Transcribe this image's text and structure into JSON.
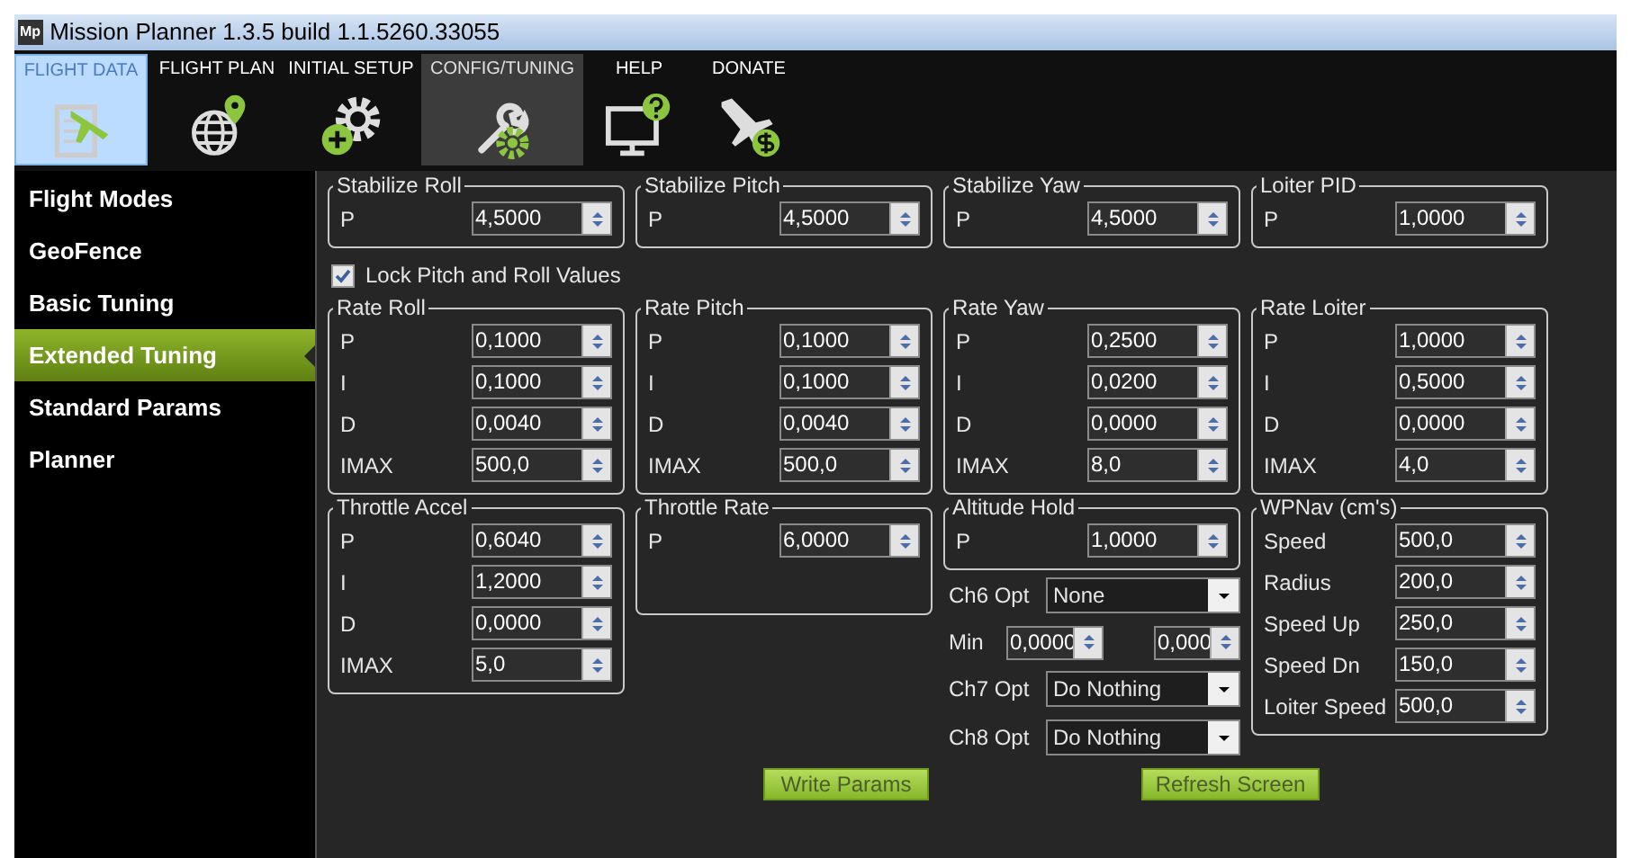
{
  "window": {
    "logo": "Mp",
    "title": "Mission Planner 1.3.5 build 1.1.5260.33055"
  },
  "toolbar": [
    {
      "label": "FLIGHT DATA",
      "selected": false,
      "highlighted": true
    },
    {
      "label": "FLIGHT PLAN",
      "selected": false,
      "highlighted": false
    },
    {
      "label": "INITIAL SETUP",
      "selected": false,
      "highlighted": false
    },
    {
      "label": "CONFIG/TUNING",
      "selected": true,
      "highlighted": false
    },
    {
      "label": "HELP",
      "selected": false,
      "highlighted": false
    },
    {
      "label": "DONATE",
      "selected": false,
      "highlighted": false
    }
  ],
  "sidebar": {
    "items": [
      {
        "label": "Flight Modes",
        "selected": false
      },
      {
        "label": "GeoFence",
        "selected": false
      },
      {
        "label": "Basic Tuning",
        "selected": false
      },
      {
        "label": "Extended Tuning",
        "selected": true
      },
      {
        "label": "Standard Params",
        "selected": false
      },
      {
        "label": "Planner",
        "selected": false
      }
    ]
  },
  "top_groups": [
    {
      "title": "Stabilize Roll",
      "params": [
        {
          "label": "P",
          "value": "4,5000"
        }
      ]
    },
    {
      "title": "Stabilize Pitch",
      "params": [
        {
          "label": "P",
          "value": "4,5000"
        }
      ]
    },
    {
      "title": "Stabilize Yaw",
      "params": [
        {
          "label": "P",
          "value": "4,5000"
        }
      ]
    },
    {
      "title": "Loiter PID",
      "params": [
        {
          "label": "P",
          "value": "1,0000"
        }
      ]
    }
  ],
  "lock_pitch_roll": {
    "label": "Lock Pitch and Roll Values",
    "checked": true
  },
  "columns": [
    [
      {
        "kind": "group",
        "title": "Rate Roll",
        "params": [
          {
            "label": "P",
            "value": "0,1000"
          },
          {
            "label": "I",
            "value": "0,1000"
          },
          {
            "label": "D",
            "value": "0,0040"
          },
          {
            "label": "IMAX",
            "value": "500,0"
          }
        ]
      },
      {
        "kind": "group",
        "title": "Throttle Accel",
        "params": [
          {
            "label": "P",
            "value": "0,6040"
          },
          {
            "label": "I",
            "value": "1,2000"
          },
          {
            "label": "D",
            "value": "0,0000"
          },
          {
            "label": "IMAX",
            "value": "5,0"
          }
        ]
      }
    ],
    [
      {
        "kind": "group",
        "title": "Rate Pitch",
        "params": [
          {
            "label": "P",
            "value": "0,1000"
          },
          {
            "label": "I",
            "value": "0,1000"
          },
          {
            "label": "D",
            "value": "0,0040"
          },
          {
            "label": "IMAX",
            "value": "500,0"
          }
        ]
      },
      {
        "kind": "group",
        "title": "Throttle Rate",
        "params": [
          {
            "label": "P",
            "value": "6,0000"
          }
        ]
      }
    ],
    [
      {
        "kind": "group",
        "title": "Rate Yaw",
        "params": [
          {
            "label": "P",
            "value": "0,2500"
          },
          {
            "label": "I",
            "value": "0,0200"
          },
          {
            "label": "D",
            "value": "0,0000"
          },
          {
            "label": "IMAX",
            "value": "8,0"
          }
        ]
      },
      {
        "kind": "group",
        "title": "Altitude Hold",
        "params": [
          {
            "label": "P",
            "value": "1,0000"
          }
        ]
      },
      {
        "kind": "dropdown",
        "label": "Ch6 Opt",
        "value": "None"
      },
      {
        "kind": "range",
        "label": "Min",
        "min": "0,0000",
        "max": "0,000"
      },
      {
        "kind": "dropdown",
        "label": "Ch7 Opt",
        "value": "Do Nothing"
      },
      {
        "kind": "dropdown",
        "label": "Ch8 Opt",
        "value": "Do Nothing"
      }
    ],
    [
      {
        "kind": "group",
        "title": "Rate Loiter",
        "params": [
          {
            "label": "P",
            "value": "1,0000"
          },
          {
            "label": "I",
            "value": "0,5000"
          },
          {
            "label": "D",
            "value": "0,0000"
          },
          {
            "label": "IMAX",
            "value": "4,0"
          }
        ]
      },
      {
        "kind": "group",
        "title": "WPNav (cm's)",
        "params": [
          {
            "label": "Speed",
            "value": "500,0"
          },
          {
            "label": "Radius",
            "value": "200,0"
          },
          {
            "label": "Speed Up",
            "value": "250,0"
          },
          {
            "label": "Speed Dn",
            "value": "150,0"
          },
          {
            "label": "Loiter Speed",
            "value": "500,0"
          }
        ]
      }
    ]
  ],
  "buttons": [
    "Write Params",
    "Refresh Screen"
  ]
}
